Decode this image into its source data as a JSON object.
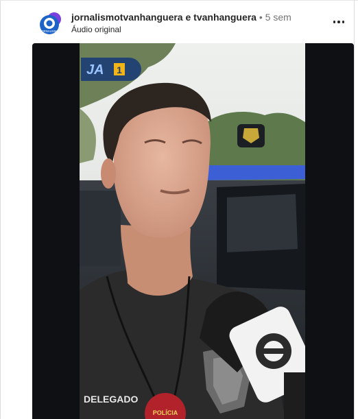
{
  "post": {
    "author": "jornalismotvanhanguera e tvanhanguera",
    "separator": "•",
    "time_ago": "5 sem",
    "audio_label": "Áudio original",
    "avatar_text": "JORNALISMO",
    "more_icon": "more-horizontal-icon"
  },
  "video": {
    "program_badge": "JA",
    "program_badge_suffix": "1",
    "vest_text": "DELEGADO",
    "seal_text": "POLÍCIA",
    "mic_logo": "globo-logo"
  },
  "colors": {
    "username": "#262626",
    "meta": "#737373",
    "video_bg": "#0e1013",
    "badge_blue": "#1d3f74",
    "badge_yellow": "#f2b416",
    "avatar_blue": "#1e63c8",
    "avatar_purple": "#7b3fe0"
  }
}
